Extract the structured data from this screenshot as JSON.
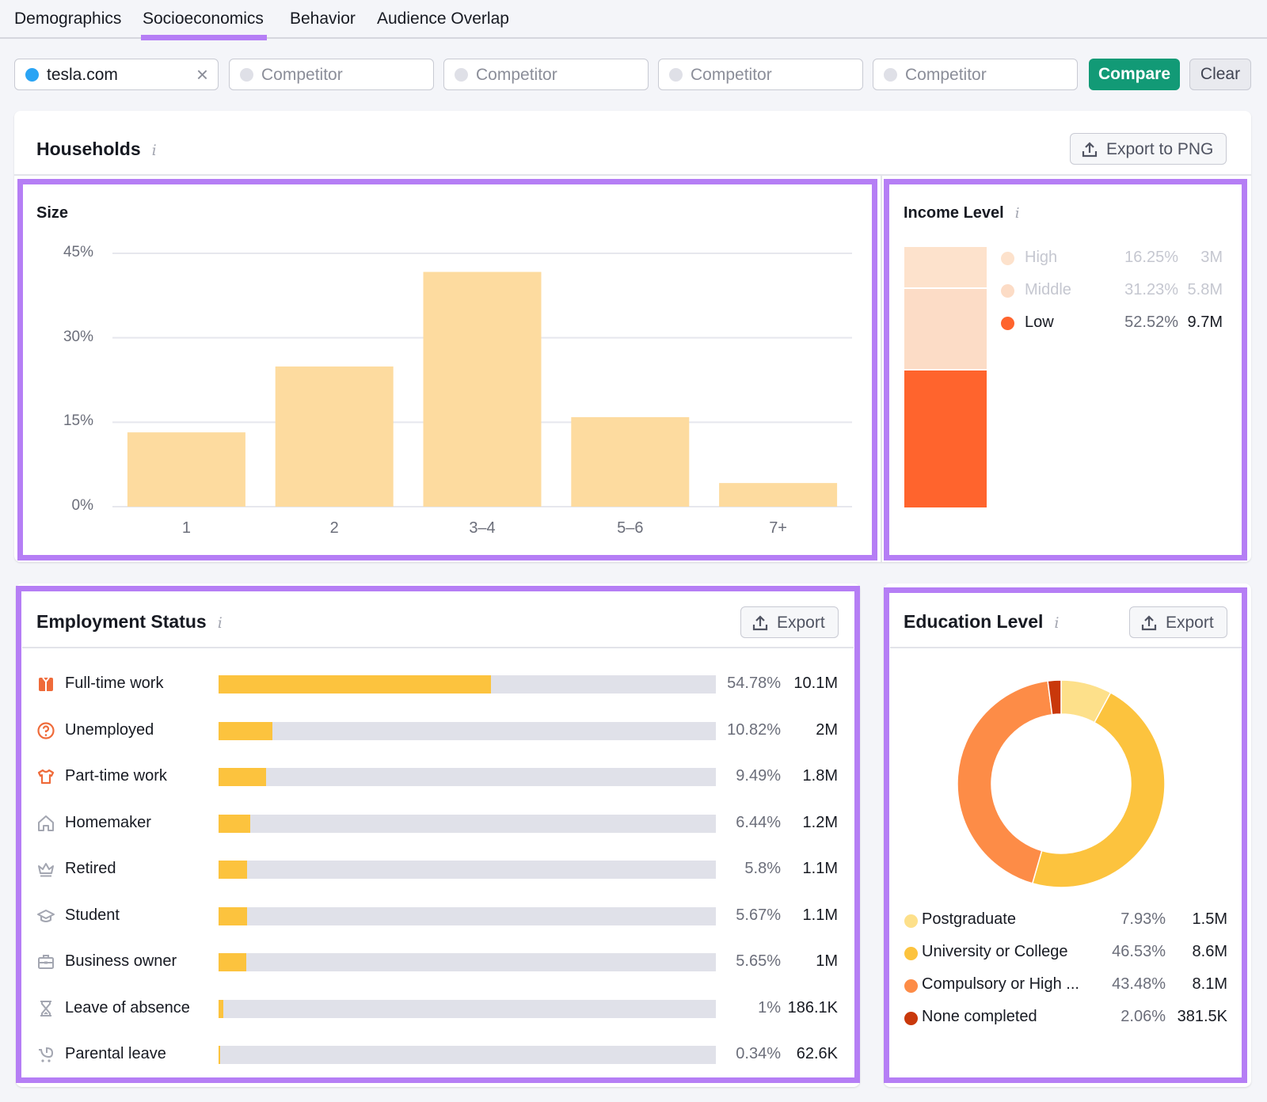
{
  "tabs": [
    {
      "label": "Demographics",
      "active": false
    },
    {
      "label": "Socioeconomics",
      "active": true
    },
    {
      "label": "Behavior",
      "active": false
    },
    {
      "label": "Audience Overlap",
      "active": false
    }
  ],
  "search": {
    "domain": {
      "value": "tesla.com",
      "dot_color": "#2aa4f4",
      "clear_icon": "close-icon"
    },
    "competitors": [
      {
        "placeholder": "Competitor"
      },
      {
        "placeholder": "Competitor"
      },
      {
        "placeholder": "Competitor"
      },
      {
        "placeholder": "Competitor"
      }
    ],
    "compare_label": "Compare",
    "clear_label": "Clear"
  },
  "households": {
    "title": "Households",
    "info_icon": "i",
    "export_label": "Export to PNG",
    "size": {
      "title": "Size"
    },
    "income": {
      "title": "Income Level",
      "items": [
        {
          "label": "High",
          "percent": "16.25%",
          "value": "3M",
          "color": "#fde2cc",
          "dimmed": true
        },
        {
          "label": "Middle",
          "percent": "31.23%",
          "value": "5.8M",
          "color": "#fcdcc6",
          "dimmed": true
        },
        {
          "label": "Low",
          "percent": "52.52%",
          "value": "9.7M",
          "color": "#ff642d",
          "dimmed": false
        }
      ]
    }
  },
  "employment": {
    "title": "Employment Status",
    "info_icon": "i",
    "export_label": "Export",
    "items": [
      {
        "label": "Full-time work",
        "icon": "shirt-tie-icon",
        "percent": "54.78%",
        "fraction": 0.5478,
        "value": "10.1M",
        "highlight": true
      },
      {
        "label": "Unemployed",
        "icon": "question-circle-icon",
        "percent": "10.82%",
        "fraction": 0.1082,
        "value": "2M",
        "highlight": true
      },
      {
        "label": "Part-time work",
        "icon": "t-shirt-icon",
        "percent": "9.49%",
        "fraction": 0.0949,
        "value": "1.8M",
        "highlight": true
      },
      {
        "label": "Homemaker",
        "icon": "house-icon",
        "percent": "6.44%",
        "fraction": 0.0644,
        "value": "1.2M",
        "highlight": false
      },
      {
        "label": "Retired",
        "icon": "crown-icon",
        "percent": "5.8%",
        "fraction": 0.058,
        "value": "1.1M",
        "highlight": false
      },
      {
        "label": "Student",
        "icon": "graduation-cap-icon",
        "percent": "5.67%",
        "fraction": 0.0567,
        "value": "1.1M",
        "highlight": false
      },
      {
        "label": "Business owner",
        "icon": "briefcase-icon",
        "percent": "5.65%",
        "fraction": 0.0565,
        "value": "1M",
        "highlight": false
      },
      {
        "label": "Leave of absence",
        "icon": "hourglass-icon",
        "percent": "1%",
        "fraction": 0.01,
        "value": "186.1K",
        "highlight": false
      },
      {
        "label": "Parental leave",
        "icon": "stroller-icon",
        "percent": "0.34%",
        "fraction": 0.0034,
        "value": "62.6K",
        "highlight": false
      }
    ],
    "colors": {
      "fill": "#fcc33e",
      "track": "#e0e1e9",
      "icon_highlight": "#ef6b3a",
      "icon_muted": "#a3a6b1"
    }
  },
  "education": {
    "title": "Education Level",
    "info_icon": "i",
    "export_label": "Export",
    "items": [
      {
        "label": "Postgraduate",
        "percent": "7.93%",
        "value": "1.5M",
        "color": "#fde08a"
      },
      {
        "label": "University or College",
        "percent": "46.53%",
        "value": "8.6M",
        "color": "#fcc33e"
      },
      {
        "label": "Compulsory or High ...",
        "percent": "43.48%",
        "value": "8.1M",
        "color": "#fd8c47"
      },
      {
        "label": "None completed",
        "percent": "2.06%",
        "value": "381.5K",
        "color": "#c9380b"
      }
    ]
  },
  "chart_data": [
    {
      "type": "bar",
      "title": "Size",
      "categories": [
        "1",
        "2",
        "3–4",
        "5–6",
        "7+"
      ],
      "values": [
        13.2,
        24.9,
        41.7,
        15.9,
        4.2
      ],
      "yticks": [
        "0%",
        "15%",
        "30%",
        "45%"
      ],
      "ylim": [
        0,
        45
      ],
      "xlabel": "",
      "ylabel": "",
      "grid": true,
      "bar_color": "#fddb9f"
    },
    {
      "type": "bar",
      "title": "Income Level",
      "stacked": true,
      "categories": [
        "High",
        "Middle",
        "Low"
      ],
      "values": [
        16.25,
        31.23,
        52.52
      ]
    },
    {
      "type": "pie",
      "title": "Education Level",
      "donut": true,
      "categories": [
        "Postgraduate",
        "University or College",
        "Compulsory or High ...",
        "None completed"
      ],
      "values": [
        7.93,
        46.53,
        43.48,
        2.06
      ]
    }
  ]
}
